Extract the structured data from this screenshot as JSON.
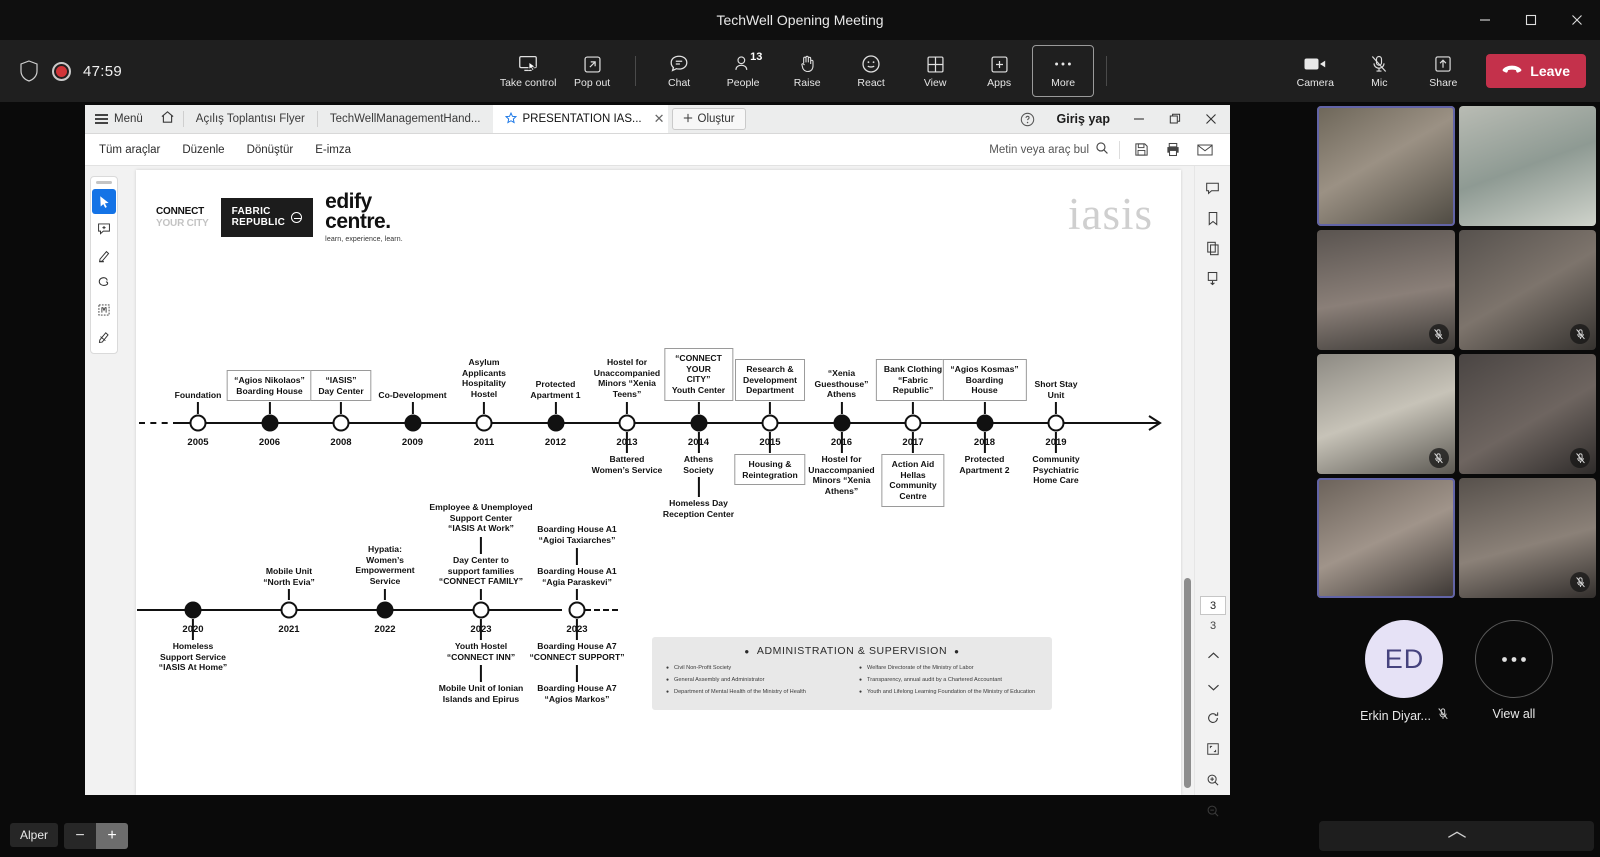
{
  "window": {
    "title": "TechWell Opening Meeting",
    "controls": {
      "minimize": "—",
      "maximize": "❐",
      "close": "✕"
    }
  },
  "meeting_bar": {
    "timer": "47:59",
    "shield_icon": "shield-icon",
    "record_icon": "recording-indicator",
    "buttons": [
      {
        "label": "Take control",
        "icon": "take-control-icon"
      },
      {
        "label": "Pop out",
        "icon": "pop-out-icon"
      },
      {
        "label": "Chat",
        "icon": "chat-icon"
      },
      {
        "label": "People",
        "icon": "people-icon",
        "badge": "13"
      },
      {
        "label": "Raise",
        "icon": "raise-hand-icon"
      },
      {
        "label": "React",
        "icon": "react-smiley-icon"
      },
      {
        "label": "View",
        "icon": "view-grid-icon"
      },
      {
        "label": "Apps",
        "icon": "apps-plus-icon"
      },
      {
        "label": "More",
        "icon": "more-ellipsis-icon",
        "boxed": true
      }
    ],
    "right_buttons": [
      {
        "label": "Camera",
        "icon": "camera-icon"
      },
      {
        "label": "Mic",
        "icon": "mic-muted-icon"
      },
      {
        "label": "Share",
        "icon": "share-up-icon"
      }
    ],
    "leave_label": "Leave",
    "leave_color": "#c4314b"
  },
  "pdf_app": {
    "menu_label": "Menü",
    "home_icon": "home-icon",
    "tabs": [
      {
        "label": "Açılış Toplantısı Flyer",
        "active": false,
        "starred": false
      },
      {
        "label": "TechWellManagementHand...",
        "active": false,
        "starred": false
      },
      {
        "label": "PRESENTATION IAS...",
        "active": true,
        "starred": true
      }
    ],
    "create_label": "Oluştur",
    "help_icon": "help-circle-icon",
    "signin_label": "Giriş yap",
    "tools": [
      "Tüm araçlar",
      "Düzenle",
      "Dönüştür",
      "E-imza"
    ],
    "find_placeholder": "Metin veya araç bul",
    "right_tool_icons": [
      "save-icon",
      "print-icon",
      "email-icon"
    ],
    "left_rail_icons": [
      "select-cursor-icon",
      "add-comment-icon",
      "highlight-icon",
      "draw-freehand-icon",
      "select-text-icon",
      "redact-icon"
    ],
    "right_rail_icons": [
      "comments-panel-icon",
      "bookmark-icon",
      "copy-pages-icon",
      "organize-pages-icon"
    ],
    "page_current": "3",
    "page_total": "3",
    "page_nav_icons": [
      "chevron-up-icon",
      "chevron-down-icon",
      "rotate-icon",
      "fit-page-icon",
      "zoom-in-icon",
      "zoom-out-icon"
    ]
  },
  "document": {
    "logos": {
      "connect_your_city": {
        "line1": "CONNECT",
        "line2": "YOUR CITY"
      },
      "fabric_republic": {
        "line1": "FABRIC",
        "line2": "REPUBLIC"
      },
      "edify": {
        "line1": "edify",
        "line2": "centre.",
        "tagline": "learn, experience, learn."
      },
      "iasis": "iasis"
    },
    "timeline_top": [
      {
        "year": "2005",
        "filled": false,
        "above": [
          "Foundation"
        ],
        "above_boxed": false,
        "below": [],
        "below_boxed": false
      },
      {
        "year": "2006",
        "filled": true,
        "above": [
          "“Agios Nikolaos”",
          "Boarding House"
        ],
        "above_boxed": true,
        "below": [],
        "below_boxed": false
      },
      {
        "year": "2008",
        "filled": false,
        "above": [
          "“IASIS”",
          "Day Center"
        ],
        "above_boxed": true,
        "below": [],
        "below_boxed": false
      },
      {
        "year": "2009",
        "filled": true,
        "above": [
          "Co-Development"
        ],
        "above_boxed": false,
        "below": [],
        "below_boxed": false
      },
      {
        "year": "2011",
        "filled": false,
        "above": [
          "Asylum",
          "Applicants",
          "Hospitality",
          "Hostel"
        ],
        "above_boxed": false,
        "below": [],
        "below_boxed": false
      },
      {
        "year": "2012",
        "filled": true,
        "above": [
          "Protected",
          "Apartment 1"
        ],
        "above_boxed": false,
        "below": [],
        "below_boxed": false
      },
      {
        "year": "2013",
        "filled": false,
        "above": [
          "Hostel for",
          "Unaccompanied",
          "Minors “Xenia",
          "Teens”"
        ],
        "above_boxed": false,
        "below": [
          "Battered",
          "Women’s Service"
        ],
        "below_boxed": false
      },
      {
        "year": "2014",
        "filled": true,
        "above": [
          "“CONNECT",
          "YOUR",
          "CITY”",
          "Youth Center"
        ],
        "above_boxed": true,
        "below": [
          "Athens",
          "Society"
        ],
        "below_boxed": false,
        "below2": [
          "Homeless Day",
          "Reception Center"
        ]
      },
      {
        "year": "2015",
        "filled": false,
        "above": [
          "Research &",
          "Development",
          "Department"
        ],
        "above_boxed": true,
        "below": [
          "Housing &",
          "Reintegration"
        ],
        "below_boxed": true
      },
      {
        "year": "2016",
        "filled": true,
        "above": [
          "“Xenia",
          "Guesthouse”",
          "Athens"
        ],
        "above_boxed": false,
        "below": [
          "Hostel for",
          "Unaccompanied",
          "Minors “Xenia",
          "Athens”"
        ],
        "below_boxed": false
      },
      {
        "year": "2017",
        "filled": false,
        "above": [
          "Bank Clothing",
          "“Fabric",
          "Republic”"
        ],
        "above_boxed": true,
        "below": [
          "Action Aid",
          "Hellas",
          "Community",
          "Centre"
        ],
        "below_boxed": true
      },
      {
        "year": "2018",
        "filled": true,
        "above": [
          "“Agios Kosmas”",
          "Boarding",
          "House"
        ],
        "above_boxed": true,
        "below": [
          "Protected",
          "Apartment 2"
        ],
        "below_boxed": false
      },
      {
        "year": "2019",
        "filled": false,
        "above": [
          "Short Stay",
          "Unit"
        ],
        "above_boxed": false,
        "below": [
          "Community",
          "Psychiatric",
          "Home Care"
        ],
        "below_boxed": false
      }
    ],
    "timeline_bottom": [
      {
        "year": "2020",
        "filled": true,
        "above": [],
        "below": [
          "Homeless",
          "Support Service",
          "“IASIS At Home”"
        ]
      },
      {
        "year": "2021",
        "filled": false,
        "above": [
          "Mobile Unit",
          "“North Evia”"
        ],
        "below": []
      },
      {
        "year": "2022",
        "filled": true,
        "above": [
          "Hypatia:",
          "Women’s",
          "Empowerment",
          "Service"
        ],
        "below": []
      },
      {
        "year": "2023",
        "filled": false,
        "above": [
          "Day Center to",
          "support families",
          "“CONNECT FAMILY”"
        ],
        "above2": [
          "Employee & Unemployed",
          "Support Center",
          "“IASIS At Work”"
        ],
        "below": [
          "Youth Hostel",
          "“CONNECT INN”"
        ],
        "below2": [
          "Mobile Unit of Ionian",
          "Islands and Epirus"
        ]
      },
      {
        "year": "2023",
        "filled": false,
        "above": [
          "Boarding House A1",
          "“Agia Paraskevi”"
        ],
        "above2": [
          "Boarding House A1",
          "“Agioi Taxiarches”"
        ],
        "below": [
          "Boarding House A7",
          "“CONNECT SUPPORT”"
        ],
        "below2": [
          "Boarding House A7",
          "“Agios Markos”"
        ]
      }
    ],
    "admin": {
      "title": "ADMINISTRATION & SUPERVISION",
      "left_items": [
        "Civil Non-Profit Society",
        "General Assembly and Administrator",
        "Department of Mental Health of the Ministry of Health"
      ],
      "right_items": [
        "Welfare Directorate of the Ministry of Labor",
        "Transparency, annual audit by a Chartered Accountant",
        "Youth and Lifelong Learning Foundation of the Ministry of Education"
      ]
    }
  },
  "roster": {
    "tiles": [
      {
        "name": "video-tile-1",
        "highlighted": true,
        "muted": false
      },
      {
        "name": "video-tile-2",
        "highlighted": false,
        "muted": false
      },
      {
        "name": "video-tile-3",
        "highlighted": false,
        "muted": true
      },
      {
        "name": "video-tile-4",
        "highlighted": false,
        "muted": true
      },
      {
        "name": "video-tile-5",
        "highlighted": false,
        "muted": true
      },
      {
        "name": "video-tile-6",
        "highlighted": false,
        "muted": true
      },
      {
        "name": "video-tile-7",
        "highlighted": true,
        "muted": false
      },
      {
        "name": "video-tile-8",
        "highlighted": false,
        "muted": true
      }
    ],
    "participant": {
      "initials": "ED",
      "name": "Erkin Diyar...",
      "muted": true
    },
    "view_all_label": "View all",
    "tray_icon": "chevron-up-icon"
  },
  "taskbar": {
    "user_chip": "Alper",
    "zoom_out": "−",
    "zoom_in": "+"
  }
}
